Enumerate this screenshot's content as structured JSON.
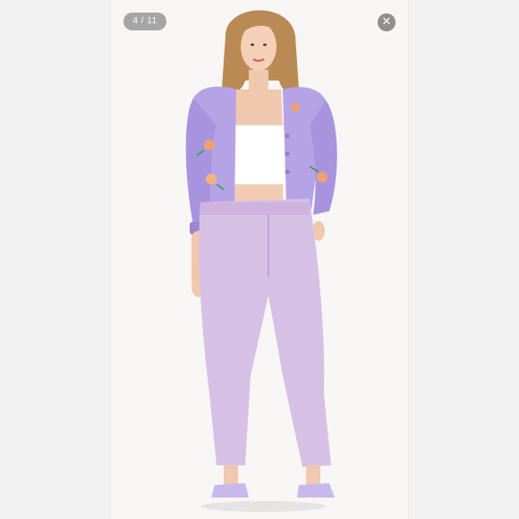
{
  "viewer": {
    "counter": "4 / 11",
    "close_icon": "close-icon",
    "accent_colors": {
      "badge_bg": "#969696",
      "close_bg": "#8f8f8f",
      "cardigan": "#b6a3e6",
      "jeans": "#d7c0e6",
      "top": "#ffffff"
    }
  },
  "photo": {
    "subject": "model-photo"
  }
}
